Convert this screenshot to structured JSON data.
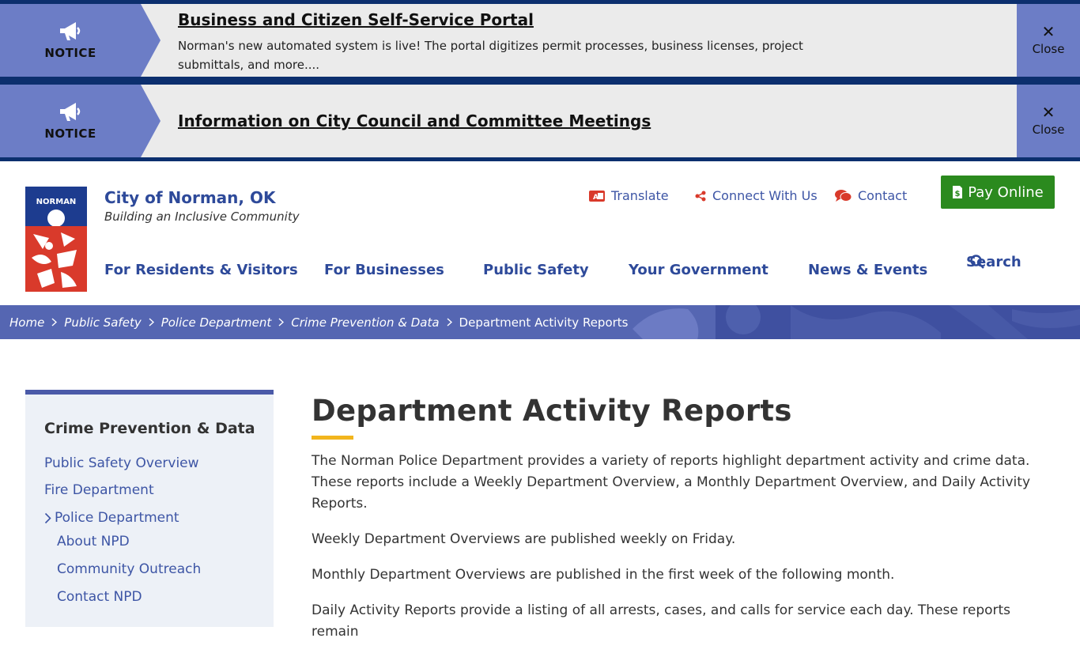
{
  "notices": [
    {
      "badge": "NOTICE",
      "title": "Business and Citizen Self-Service Portal",
      "text": "Norman's new automated system is live! The portal digitizes permit processes, business licenses, project submittals, and more....",
      "close": "Close"
    },
    {
      "badge": "NOTICE",
      "title": "Information on City Council and Committee Meetings",
      "close": "Close"
    }
  ],
  "header": {
    "logo_text": "NORMAN",
    "site_name": "City of Norman, OK",
    "tagline": "Building an Inclusive Community",
    "translate": "Translate",
    "connect": "Connect With Us",
    "contact": "Contact",
    "pay": "Pay Online"
  },
  "nav": {
    "residents": "For Residents & Visitors",
    "businesses": "For Businesses",
    "safety": "Public Safety",
    "government": "Your Government",
    "news": "News & Events",
    "search": "Search"
  },
  "breadcrumb": {
    "items": [
      "Home",
      "Public Safety",
      "Police Department",
      "Crime Prevention & Data"
    ],
    "current": "Department Activity Reports"
  },
  "sidebar": {
    "heading": "Crime Prevention & Data",
    "items": [
      "Public Safety Overview",
      "Fire Department",
      "Police Department",
      "About NPD",
      "Community Outreach",
      "Contact NPD"
    ]
  },
  "content": {
    "title": "Department Activity Reports",
    "paragraphs": [
      "The Norman Police Department provides a variety of reports highlight department activity and crime data. These reports include a Weekly Department Overview, a Monthly Department Overview, and Daily Activity Reports.",
      "Weekly Department Overviews are published weekly on Friday.",
      "Monthly Department Overviews are published in the first week of the following month.",
      "Daily Activity Reports provide a listing of all arrests, cases, and calls for service each day. These reports remain"
    ]
  },
  "colors": {
    "navy": "#0c2f6e",
    "badge": "#6c7dc6",
    "link": "#2e4a9a",
    "pay": "#2b8a1e",
    "accent": "#f2b51d"
  },
  "icons": [
    "megaphone-icon",
    "close-icon",
    "translate-icon",
    "share-icon",
    "chat-icon",
    "receipt-icon",
    "search-icon",
    "chevron-right-icon"
  ]
}
